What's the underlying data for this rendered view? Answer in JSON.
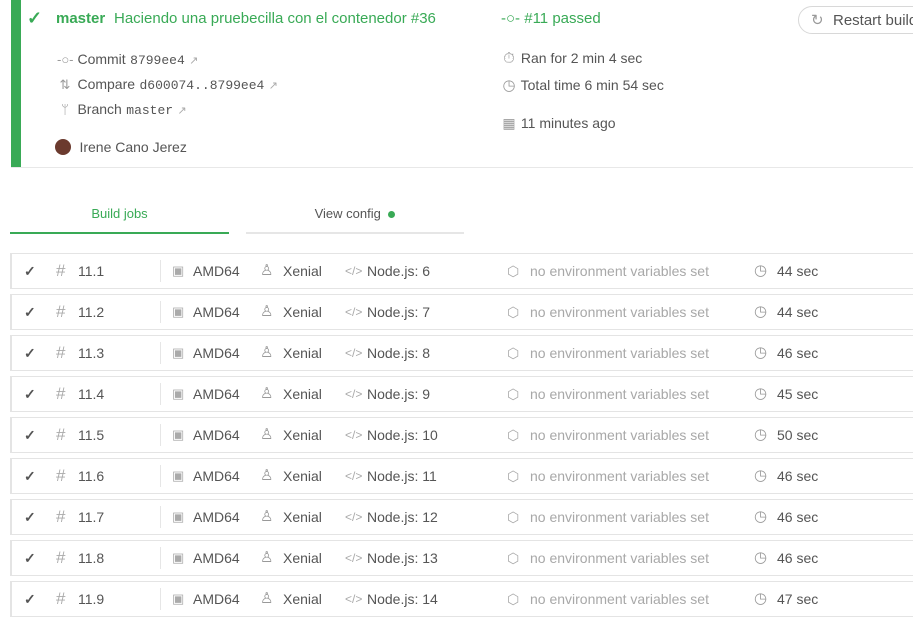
{
  "build": {
    "branch": "master",
    "message": "Haciendo una pruebecilla con el contenedor #36",
    "status": "#11 passed",
    "commit_label": "Commit",
    "commit_hash": "8799ee4",
    "compare_label": "Compare",
    "compare_range": "d600074..8799ee4",
    "branch_label": "Branch",
    "branch_name": "master",
    "author": "Irene Cano Jerez",
    "ran_for": "Ran for 2 min 4 sec",
    "total_time": "Total time 6 min 54 sec",
    "when": "11 minutes ago",
    "restart_label": "Restart build"
  },
  "tabs": {
    "build_jobs": "Build jobs",
    "view_config": "View config"
  },
  "colors": {
    "passed": "#39aa56",
    "muted": "#a8a8a8"
  },
  "jobs": [
    {
      "number": "11.1",
      "arch": "AMD64",
      "os": "Xenial",
      "lang": "Node.js: 6",
      "env": "no environment variables set",
      "duration": "44 sec"
    },
    {
      "number": "11.2",
      "arch": "AMD64",
      "os": "Xenial",
      "lang": "Node.js: 7",
      "env": "no environment variables set",
      "duration": "44 sec"
    },
    {
      "number": "11.3",
      "arch": "AMD64",
      "os": "Xenial",
      "lang": "Node.js: 8",
      "env": "no environment variables set",
      "duration": "46 sec"
    },
    {
      "number": "11.4",
      "arch": "AMD64",
      "os": "Xenial",
      "lang": "Node.js: 9",
      "env": "no environment variables set",
      "duration": "45 sec"
    },
    {
      "number": "11.5",
      "arch": "AMD64",
      "os": "Xenial",
      "lang": "Node.js: 10",
      "env": "no environment variables set",
      "duration": "50 sec"
    },
    {
      "number": "11.6",
      "arch": "AMD64",
      "os": "Xenial",
      "lang": "Node.js: 11",
      "env": "no environment variables set",
      "duration": "46 sec"
    },
    {
      "number": "11.7",
      "arch": "AMD64",
      "os": "Xenial",
      "lang": "Node.js: 12",
      "env": "no environment variables set",
      "duration": "46 sec"
    },
    {
      "number": "11.8",
      "arch": "AMD64",
      "os": "Xenial",
      "lang": "Node.js: 13",
      "env": "no environment variables set",
      "duration": "46 sec"
    },
    {
      "number": "11.9",
      "arch": "AMD64",
      "os": "Xenial",
      "lang": "Node.js: 14",
      "env": "no environment variables set",
      "duration": "47 sec"
    }
  ]
}
